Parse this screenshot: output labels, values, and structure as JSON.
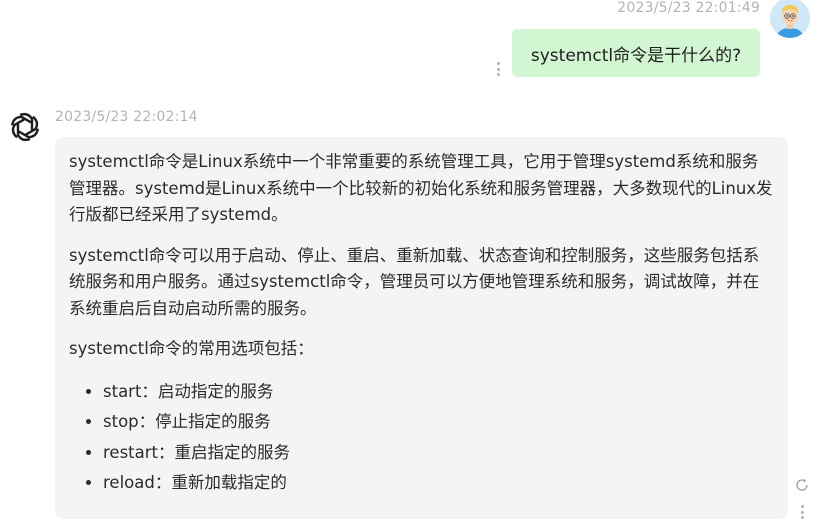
{
  "user_message": {
    "timestamp": "2023/5/23 22:01:49",
    "text": "systemctl命令是干什么的?",
    "avatar_icon": "user-avatar-icon"
  },
  "assistant_message": {
    "timestamp": "2023/5/23 22:02:14",
    "avatar_icon": "openai-logo-icon",
    "paragraphs": [
      "systemctl命令是Linux系统中一个非常重要的系统管理工具，它用于管理systemd系统和服务管理器。systemd是Linux系统中一个比较新的初始化系统和服务管理器，大多数现代的Linux发行版都已经采用了systemd。",
      "systemctl命令可以用于启动、停止、重启、重新加载、状态查询和控制服务，这些服务包括系统服务和用户服务。通过systemctl命令，管理员可以方便地管理系统和服务，调试故障，并在系统重启后自动启动所需的服务。",
      "systemctl命令的常用选项包括："
    ],
    "list_items": [
      "start：启动指定的服务",
      "stop：停止指定的服务",
      "restart：重启指定的服务",
      "reload：重新加载指定的"
    ]
  },
  "icons": {
    "message_menu": "more-vertical-icon",
    "refresh": "refresh-icon"
  },
  "colors": {
    "user_bubble": "#d2f5d2",
    "assistant_bubble": "#f3f4f6",
    "timestamp": "#b0b3b8"
  }
}
